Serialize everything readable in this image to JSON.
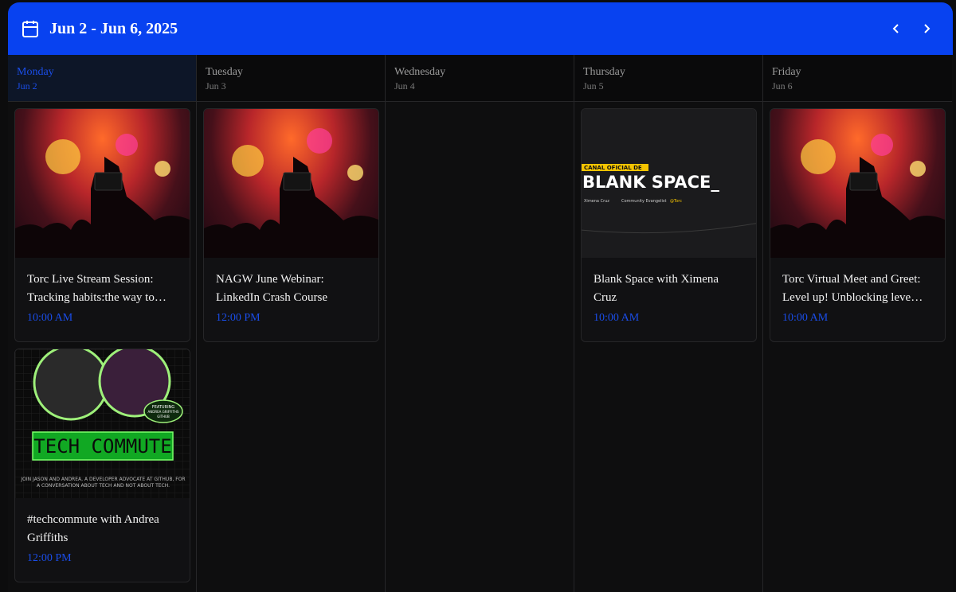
{
  "header": {
    "title": "Jun 2 - Jun 6, 2025",
    "icon": "calendar-icon",
    "prev_icon": "chevron-left-icon",
    "next_icon": "chevron-right-icon",
    "accent": "#0842f0"
  },
  "columns": [
    {
      "day": "Monday",
      "date": "Jun 2",
      "active": true
    },
    {
      "day": "Tuesday",
      "date": "Jun 3"
    },
    {
      "day": "Wednesday",
      "date": "Jun 4"
    },
    {
      "day": "Thursday",
      "date": "Jun 5"
    },
    {
      "day": "Friday",
      "date": "Jun 6"
    }
  ],
  "events": {
    "mon1": {
      "title": "Torc Live Stream Session: Tracking habits:the way to…",
      "time": "10:00 AM"
    },
    "mon2": {
      "title": "#techcommute with Andrea Griffiths",
      "time": "12:00 PM",
      "image": {
        "banner": "TECH COMMUTE",
        "featuring": "FEATURING",
        "guest": "ANDREA GRIFFITHS",
        "org": "GITHUB",
        "caption": "JOIN JASON AND ANDREA, A DEVELOPER ADVOCATE AT GITHUB, FOR A CONVERSATION ABOUT TECH AND NOT ABOUT TECH."
      }
    },
    "tue1": {
      "title": "NAGW June Webinar: LinkedIn Crash Course",
      "time": "12:00 PM"
    },
    "thu1": {
      "title": "Blank Space with Ximena Cruz",
      "time": "10:00 AM",
      "image": {
        "tag": "CANAL OFICIAL DE",
        "headline": "BLANK SPACE_",
        "name": "Ximena Cruz",
        "role": "Community Evangelist",
        "handle": "@Torc"
      }
    },
    "fri1": {
      "title": "Torc Virtual Meet and Greet: Level up! Unblocking leve…",
      "time": "10:00 AM"
    }
  }
}
